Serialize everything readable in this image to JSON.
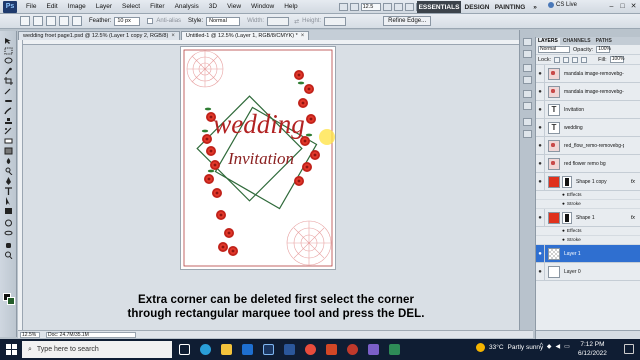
{
  "menubar": {
    "items": [
      "File",
      "Edit",
      "Image",
      "Layer",
      "Select",
      "Filter",
      "Analysis",
      "3D",
      "View",
      "Window",
      "Help"
    ],
    "zoom": "12.5",
    "workspaces": [
      "ESSENTIALS",
      "DESIGN",
      "PAINTING",
      "»"
    ],
    "cslive": "CS Live"
  },
  "options": {
    "feather_label": "Feather:",
    "feather_value": "10 px",
    "antialias_label": "Anti-alias",
    "style_label": "Style:",
    "style_value": "Normal",
    "width_label": "Width:",
    "height_label": "Height:",
    "refine": "Refine Edge..."
  },
  "tabs": [
    {
      "label": "wedding froet page1.psd @ 12.5% (Layer 1 copy 2, RGB/8)"
    },
    {
      "label": "Untitled-1 @ 12.5% (Layer 1, RGB/8/CMYK) *"
    }
  ],
  "artwork": {
    "line1": "wedding",
    "line2": "Invitation",
    "accent": "#b22222",
    "frame_color": "#2f6a3a"
  },
  "caption": {
    "line1": "Extra corner can be deleted first select the corner",
    "line2": "through rectangular marquee tool and press the DEL."
  },
  "status": {
    "zoom": "12.5%",
    "doc": "Doc: 24.7M/35.1M"
  },
  "layers_panel": {
    "tabs": [
      "LAYERS",
      "CHANNELS",
      "PATHS"
    ],
    "blend": "Normal",
    "opacity_label": "Opacity:",
    "opacity": "100%",
    "lock_label": "Lock:",
    "fill_label": "Fill:",
    "fill": "100%",
    "layers": [
      {
        "name": "mandala image-removebg-p...",
        "thumb": "img"
      },
      {
        "name": "mandala image-removebg-p...",
        "thumb": "img"
      },
      {
        "name": "Invitation",
        "thumb": "text"
      },
      {
        "name": "wedding",
        "thumb": "text"
      },
      {
        "name": "red_flow_remo-removebg-p...",
        "thumb": "img"
      },
      {
        "name": "red flower remo bg",
        "thumb": "img"
      },
      {
        "name": "Shape 1 copy",
        "thumb": "red",
        "fx": true,
        "effects": [
          "Effects",
          "Stroke"
        ]
      },
      {
        "name": "Shape 1",
        "thumb": "red",
        "fx": true,
        "effects": [
          "Effects",
          "Stroke"
        ]
      },
      {
        "name": "Layer 1",
        "thumb": "checker",
        "selected": true
      },
      {
        "name": "Layer 0",
        "thumb": "white"
      }
    ]
  },
  "taskbar": {
    "search_placeholder": "Type here to search",
    "weather_temp": "33°C",
    "weather_text": "Partly sunny",
    "time": "7:12 PM",
    "date": "6/12/2022"
  }
}
